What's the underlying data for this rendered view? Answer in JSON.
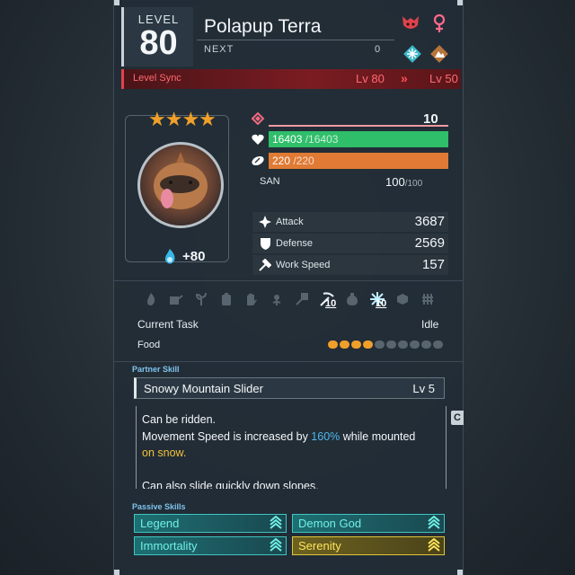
{
  "header": {
    "level_label": "LEVEL",
    "level_value": "80",
    "pal_name": "Polapup Terra",
    "next_label": "NEXT",
    "next_value": "0",
    "icons": [
      "boss-icon",
      "female-gender-icon",
      "ice-element-icon",
      "ground-element-icon"
    ]
  },
  "level_sync": {
    "label": "Level Sync",
    "from": "Lv 80",
    "arrow": "»",
    "to": "Lv 50"
  },
  "portrait": {
    "stars": "★★★★",
    "soul_bonus": "+80"
  },
  "stats": {
    "rank_value": "10",
    "hp_current": "16403",
    "hp_max": "/16403",
    "hp_fill": 1.0,
    "stomach_current": "220",
    "stomach_max": "/220",
    "stomach_fill": 1.0,
    "san_label": "SAN",
    "san_current": "100",
    "san_max": "/100",
    "attack_label": "Attack",
    "attack_value": "3687",
    "defense_label": "Defense",
    "defense_value": "2569",
    "work_speed_label": "Work Speed",
    "work_speed_value": "157"
  },
  "work_suitability": {
    "icons": [
      "kindling-icon",
      "watering-icon",
      "planting-icon",
      "electricity-icon",
      "handiwork-icon",
      "gathering-icon",
      "lumbering-icon",
      "mining-icon",
      "medicine-icon",
      "cooling-icon",
      "transporting-icon",
      "farming-icon"
    ],
    "mining_level": "10",
    "cooling_level": "10"
  },
  "task": {
    "current_task_label": "Current Task",
    "current_task_value": "Idle",
    "food_label": "Food",
    "food_filled": 4,
    "food_total": 10
  },
  "partner_skill": {
    "section_label": "Partner Skill",
    "name": "Snowy Mountain Slider",
    "level": "Lv  5",
    "line1": "Can be ridden.",
    "line2_a": "Movement Speed is increased by ",
    "line2_b": "160%",
    "line2_c": " while mounted",
    "line3": "on snow.",
    "line4": "Can also slide quickly down slopes.",
    "scroll_hint": "C"
  },
  "passive_skills": {
    "section_label": "Passive Skills",
    "items": [
      {
        "name": "Legend",
        "tier": "teal"
      },
      {
        "name": "Demon God",
        "tier": "teal"
      },
      {
        "name": "Immortality",
        "tier": "teal"
      },
      {
        "name": "Serenity",
        "tier": "gold"
      }
    ]
  },
  "colors": {
    "hp_bar": "#2fbe6a",
    "stomach_bar": "#e07a34",
    "level_sync_red": "#e0434c",
    "star_gold": "#f0a02a",
    "accent_blue": "#4fb6f0",
    "accent_yellow": "#f0c23a"
  }
}
